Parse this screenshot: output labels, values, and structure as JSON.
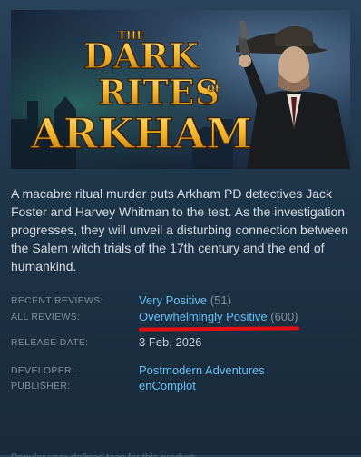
{
  "capsule": {
    "title_line1": "THE",
    "title_line2": "DARK",
    "title_line3": "RITES",
    "title_line3_small": "OF",
    "title_line4": "ARKHAM"
  },
  "description": "A macabre ritual murder puts Arkham PD detectives Jack Foster and Harvey Whitman to the test. As the investigation progresses, they will unveil a disturbing connection between the Salem witch trials of the 17th century and the end of humankind.",
  "reviews": {
    "recent_label": "RECENT REVIEWS:",
    "recent_summary": "Very Positive",
    "recent_count": "(51)",
    "all_label": "ALL REVIEWS:",
    "all_summary": "Overwhelmingly Positive",
    "all_count": "(600)"
  },
  "release": {
    "label": "RELEASE DATE:",
    "date": "3 Feb, 2026"
  },
  "developer": {
    "label": "DEVELOPER:",
    "name": "Postmodern Adventures"
  },
  "publisher": {
    "label": "PUBLISHER:",
    "name": "enComplot"
  },
  "tags_hint": "Popular user-defined tags for this product:",
  "colors": {
    "link": "#66c0f4",
    "label": "#7e8e9d",
    "annotation": "#e40f12"
  }
}
